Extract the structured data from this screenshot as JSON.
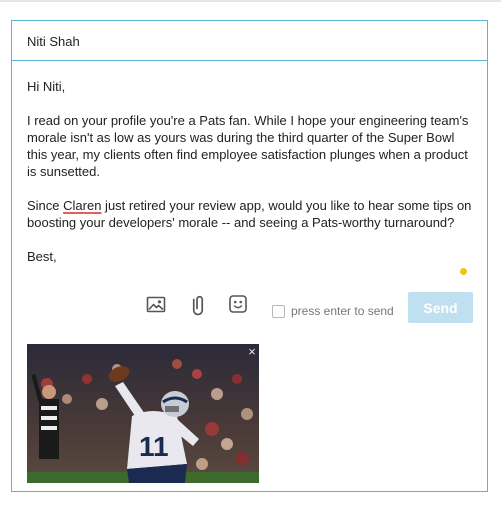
{
  "recipient": {
    "name": "Niti Shah"
  },
  "message": {
    "greeting": "Hi Niti,",
    "paragraph1": "I read on your profile you're a Pats fan. While I hope your engineering team's morale isn't as low as yours was during the third quarter of the Super Bowl this year, my clients often find employee satisfaction plunges when a product is sunsetted.",
    "paragraph2_before": "Since ",
    "paragraph2_flagged": "Claren",
    "paragraph2_after": " just retired your review app, would you like to hear some tips on boosting your developers' morale -- and seeing a Pats-worthy turnaround?",
    "signoff": "Best,"
  },
  "toolbar": {
    "icons": [
      "image-icon",
      "paperclip-icon",
      "emoji-icon"
    ],
    "press_enter_label": "press enter to send",
    "press_enter_checked": false,
    "send_label": "Send"
  },
  "attachment": {
    "jersey_number": "11",
    "close_symbol": "×"
  },
  "colors": {
    "border": "#5fb3d2",
    "send_button": "#bfe0f0",
    "status_dot": "#f3c21f",
    "spellcheck_underline": "#e06060"
  }
}
